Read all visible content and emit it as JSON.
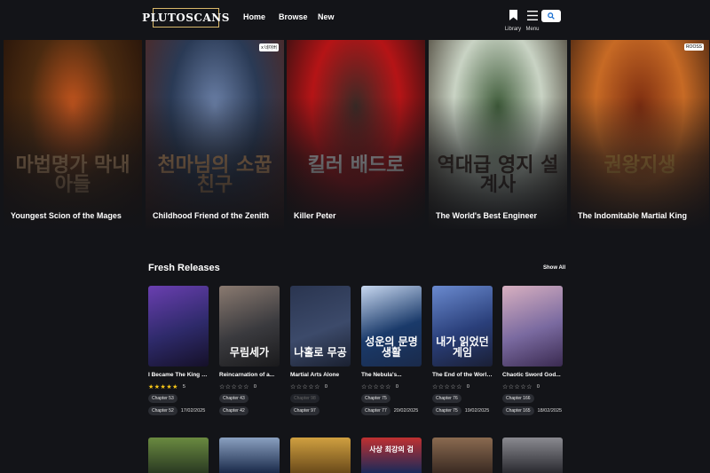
{
  "nav": {
    "logo": "PLUTOSCANS",
    "links": [
      "Home",
      "Browse",
      "New"
    ],
    "library_label": "Library",
    "menu_label": "Menu"
  },
  "hero": [
    {
      "title": "Youngest Scion of the Mages",
      "korean": "마법명가 막내아들",
      "badge": "",
      "colors": [
        "#4a2a10",
        "#c2541d",
        "#1b0d08"
      ],
      "kor_color": "#c99b6a"
    },
    {
      "title": "Childhood Friend of the Zenith",
      "korean": "천마님의 소꿉친구",
      "badge": "x 네이버",
      "colors": [
        "#2a3a55",
        "#6a7fa6",
        "#5a2418"
      ],
      "kor_color": "#d6a06a"
    },
    {
      "title": "Killer Peter",
      "korean": "킬러 배드로",
      "badge": "",
      "colors": [
        "#b51416",
        "#3a2a26",
        "#0f0f10"
      ],
      "kor_color": "#f2f2f2"
    },
    {
      "title": "The World's Best Engineer",
      "korean": "역대급 영지 설계사",
      "badge": "",
      "colors": [
        "#c9d3c4",
        "#3f5c3a",
        "#2a1f14"
      ],
      "kor_color": "#3a2a20"
    },
    {
      "title": "The Indomitable Martial King",
      "korean": "권왕지생",
      "badge": "ROOSS",
      "colors": [
        "#c76a25",
        "#7d2d10",
        "#2b150c"
      ],
      "kor_color": "#e0a040"
    }
  ],
  "fresh": {
    "title": "Fresh Releases",
    "show_all": "Show All",
    "items": [
      {
        "title": "I Became The King by...",
        "stars": "★★★★★",
        "rating": "5",
        "filled": true,
        "korean": "",
        "ch1": "Chapter 53",
        "ch1_dim": false,
        "ch2": "Chapter 52",
        "date": "17/02/2025",
        "colors": [
          "#2e2a6a",
          "#6a3fb0",
          "#151028"
        ]
      },
      {
        "title": "Reincarnation of a...",
        "stars": "☆☆☆☆☆",
        "rating": "0",
        "filled": false,
        "korean": "무림세가",
        "ch1": "Chapter 43",
        "ch1_dim": false,
        "ch2": "Chapter 42",
        "date": "",
        "colors": [
          "#3a3a3e",
          "#8a7a70",
          "#1a1a1c"
        ]
      },
      {
        "title": "Martial Arts Alone",
        "stars": "☆☆☆☆☆",
        "rating": "0",
        "filled": false,
        "korean": "나홀로 무공",
        "ch1": "Chapter 98",
        "ch1_dim": true,
        "ch2": "Chapter 97",
        "date": "",
        "colors": [
          "#3c4a6a",
          "#2a3550",
          "#1a2030"
        ]
      },
      {
        "title": "The Nebula's...",
        "stars": "☆☆☆☆☆",
        "rating": "0",
        "filled": false,
        "korean": "성운의 문명생활",
        "ch1": "Chapter 75",
        "ch1_dim": false,
        "ch2": "Chapter 77",
        "date": "20/02/2025",
        "colors": [
          "#1a3a6a",
          "#c8d8f0",
          "#1a2a4a"
        ]
      },
      {
        "title": "The End of the World I...",
        "stars": "☆☆☆☆☆",
        "rating": "0",
        "filled": false,
        "korean": "내가 읽었던 게임",
        "ch1": "Chapter 76",
        "ch1_dim": false,
        "ch2": "Chapter 75",
        "date": "19/02/2025",
        "colors": [
          "#2a3f7a",
          "#6a8acf",
          "#1a1f35"
        ]
      },
      {
        "title": "Chaotic Sword God...",
        "stars": "☆☆☆☆☆",
        "rating": "0",
        "filled": false,
        "korean": "",
        "ch1": "Chapter 166",
        "ch1_dim": false,
        "ch2": "Chapter 165",
        "date": "18/02/2025",
        "colors": [
          "#7a6aa0",
          "#d8b0c0",
          "#3a2a50"
        ]
      }
    ]
  },
  "bottom_row": [
    {
      "korean": "",
      "colors": [
        "#2a3a22",
        "#6a8a40"
      ]
    },
    {
      "korean": "",
      "colors": [
        "#1a2a4a",
        "#8aa0c0"
      ]
    },
    {
      "korean": "",
      "colors": [
        "#6a4a1a",
        "#d0a040"
      ]
    },
    {
      "korean": "사상 최강의 검",
      "colors": [
        "#1a2a5a",
        "#c03030"
      ]
    },
    {
      "korean": "",
      "colors": [
        "#3a2a22",
        "#8a6a50"
      ]
    },
    {
      "korean": "",
      "colors": [
        "#2a2a30",
        "#8a8a90"
      ]
    }
  ]
}
